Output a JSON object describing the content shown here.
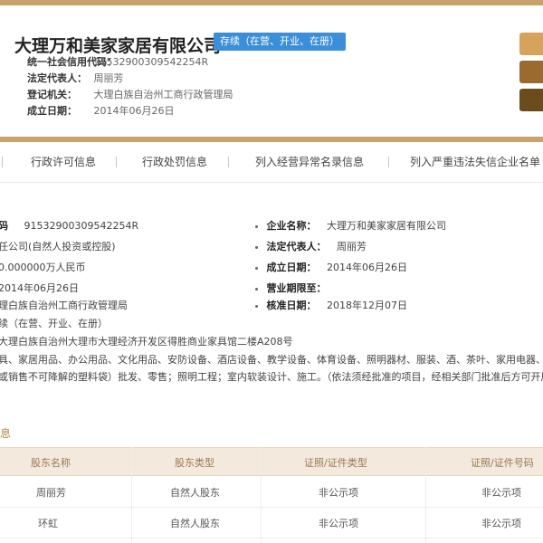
{
  "company": {
    "name": "大理万和美家家居有限公司",
    "status_badge": "存续（在营、开业、在册）",
    "fields": [
      {
        "label": "统一社会信用代码：",
        "value": "91532900309542254R"
      },
      {
        "label": "法定代表人：",
        "value": "周丽芳"
      },
      {
        "label": "登记机关：",
        "value": "大理白族自治州工商行政管理局"
      },
      {
        "label": "成立日期：",
        "value": "2014年06月26日"
      }
    ]
  },
  "header_buttons": {
    "colors": [
      "#d5a35a",
      "#9a6a2f",
      "#6b4d1d"
    ]
  },
  "tabs": [
    {
      "label": "行政许可信息"
    },
    {
      "label": "行政处罚信息"
    },
    {
      "label": "列入经营异常名录信息"
    },
    {
      "label": "列入严重违法失信企业名单（"
    }
  ],
  "details": {
    "left": [
      {
        "label": "码",
        "value": "91532900309542254R"
      },
      {
        "label": "",
        "value": "任公司(自然人投资或控股)"
      },
      {
        "label": "",
        "value": "0.000000万人民币"
      },
      {
        "label": "",
        "value": "2014年06月26日"
      },
      {
        "label": "",
        "value": "理白族自治州工商行政管理局"
      },
      {
        "label": "",
        "value": "续（在营、开业、在册）"
      }
    ],
    "right": [
      {
        "label": "企业名称：",
        "value": "大理万和美家家居有限公司"
      },
      {
        "label": "法定代表人：",
        "value": "周丽芳"
      },
      {
        "label": "成立日期：",
        "value": "2014年06月26日"
      },
      {
        "label": "营业期限至：",
        "value": ""
      },
      {
        "label": "核准日期：",
        "value": "2018年12月07日"
      }
    ],
    "address": "大理白族自治州大理市大理经济开发区得胜商业家具馆二楼A208号",
    "scope_line1": "具、家居用品、办公用品、文化用品、安防设备、酒店设备、教学设备、体育设备、照明器材、服装、酒、茶叶、家用电器、日用百货（",
    "scope_line2": "或销售不可降解的塑料袋）批发、零售；照明工程；室内软装设计、施工。（依法须经批准的项目，经相关部门批准后方可开展经营活动"
  },
  "shareholders": {
    "title": "息",
    "headers": [
      "股东名称",
      "股东类型",
      "证照/证件类型",
      "证照/证件号码"
    ],
    "rows": [
      [
        "周丽芳",
        "自然人股东",
        "非公示项",
        "非公示项"
      ],
      [
        "环虹",
        "自然人股东",
        "非公示项",
        "非公示项"
      ]
    ]
  }
}
